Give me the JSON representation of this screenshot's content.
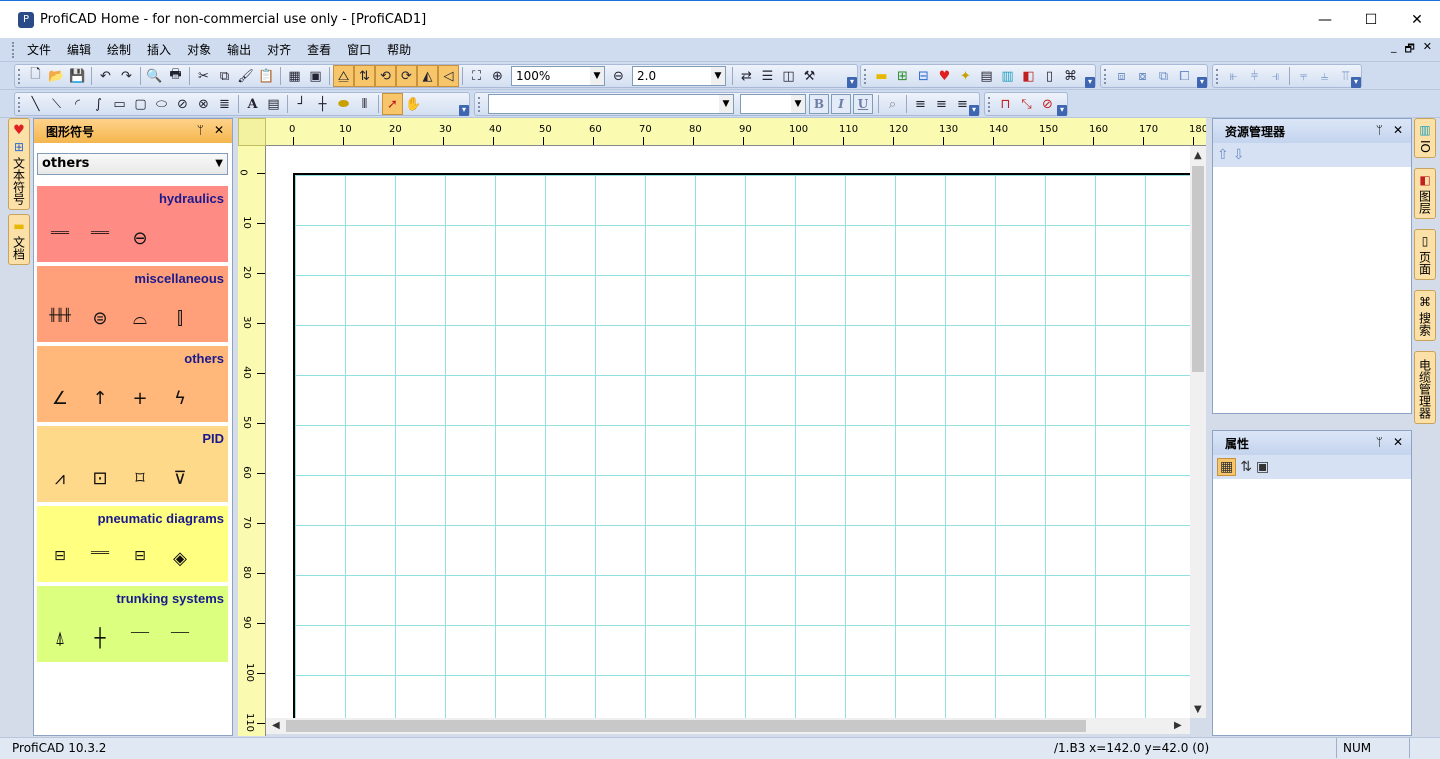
{
  "window": {
    "title": "ProfiCAD Home - for non-commercial use only - [ProfiCAD1]",
    "logo_glyph": "P",
    "minimize": "—",
    "maximize": "☐",
    "close": "✕"
  },
  "menu": {
    "items": [
      "文件",
      "编辑",
      "绘制",
      "插入",
      "对象",
      "输出",
      "对齐",
      "查看",
      "窗口",
      "帮助"
    ],
    "mdi_min": "_",
    "mdi_restore": "🗗",
    "mdi_close": "✕"
  },
  "toolbar": {
    "zoom_value": "100%",
    "line_width_value": "2.0",
    "font_name_value": "",
    "font_size_value": "",
    "bold_label": "B",
    "italic_label": "I",
    "underline_label": "U",
    "text_tool_label": "A"
  },
  "left_tabs": [
    {
      "label": "文本符号"
    },
    {
      "label": "文档"
    }
  ],
  "symbols_panel": {
    "title": "图形符号",
    "pin": "ᛘ",
    "close": "✕",
    "selected_library": "others",
    "categories": [
      {
        "name": "hydraulics",
        "color": "#ff8c84",
        "icons": [
          "═══",
          "═══",
          "⊖"
        ]
      },
      {
        "name": "miscellaneous",
        "color": "#ffa07a",
        "icons": [
          "╫╫╫",
          "⊜",
          "⌓",
          "⫿"
        ]
      },
      {
        "name": "others",
        "color": "#ffb77a",
        "icons": [
          "∠",
          "↑",
          "+",
          "ϟ"
        ]
      },
      {
        "name": "PID",
        "color": "#ffd98a",
        "icons": [
          "⩘",
          "⊡",
          "⌑",
          "⊽"
        ]
      },
      {
        "name": "pneumatic diagrams",
        "color": "#ffff80",
        "icons": [
          "⊟",
          "═══",
          "⊟",
          "◈"
        ]
      },
      {
        "name": "trunking systems",
        "color": "#dcff80",
        "icons": [
          "⍋",
          "┼",
          "───",
          "───"
        ]
      }
    ]
  },
  "rulers": {
    "top_labels": [
      "0",
      "10",
      "20",
      "30",
      "40",
      "50",
      "60",
      "70",
      "80",
      "90",
      "100",
      "110",
      "120",
      "130",
      "140",
      "150",
      "160",
      "170",
      "180"
    ],
    "left_labels": [
      "0",
      "10",
      "20",
      "30",
      "40",
      "50",
      "60",
      "70",
      "80",
      "90",
      "100",
      "110"
    ]
  },
  "resource_panel": {
    "title": "资源管理器",
    "up_icon": "⇧",
    "down_icon": "⇩",
    "pin": "ᛘ",
    "close": "✕"
  },
  "properties_panel": {
    "title": "属性",
    "pin": "ᛘ",
    "close": "✕"
  },
  "right_tabs": [
    {
      "label": "IO"
    },
    {
      "label": "图层"
    },
    {
      "label": "页面"
    },
    {
      "label": "搜索"
    },
    {
      "label": "电缆管理器"
    }
  ],
  "status": {
    "version": "ProfiCAD 10.3.2",
    "coords": "/1.B3  x=142.0  y=42.0 (0)",
    "num": "NUM"
  }
}
